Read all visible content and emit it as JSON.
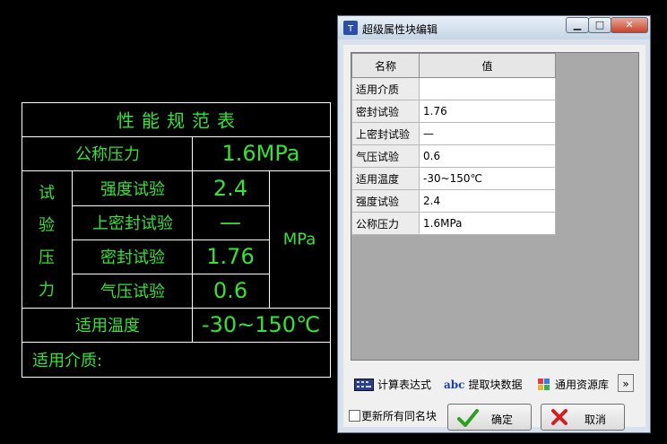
{
  "cad_table": {
    "title": "性能规范表",
    "nominal_pressure_label": "公称压力",
    "nominal_pressure_value": "1.6MPa",
    "group_label_chars": [
      "试",
      "验",
      "压",
      "力"
    ],
    "rows": [
      {
        "label": "强度试验",
        "value": "2.4"
      },
      {
        "label": "上密封试验",
        "value": "—"
      },
      {
        "label": "密封试验",
        "value": "1.76"
      },
      {
        "label": "气压试验",
        "value": "0.6"
      }
    ],
    "unit": "MPa",
    "temp_label": "适用温度",
    "temp_value": "-30~150℃",
    "medium_label": "适用介质:"
  },
  "dialog": {
    "title": "超级属性块编辑",
    "window_buttons": {
      "minimize": "▁",
      "maximize": "□",
      "close": "✕"
    },
    "grid": {
      "headers": [
        "名称",
        "值"
      ],
      "rows": [
        {
          "name": "适用介质",
          "value": ""
        },
        {
          "name": "密封试验",
          "value": "1.76"
        },
        {
          "name": "上密封试验",
          "value": "—"
        },
        {
          "name": "气压试验",
          "value": "0.6"
        },
        {
          "name": "适用温度",
          "value": "-30~150℃"
        },
        {
          "name": "强度试验",
          "value": "2.4"
        },
        {
          "name": "公称压力",
          "value": "1.6MPa"
        }
      ]
    },
    "toolbar": {
      "calc_label": "计算表达式",
      "abc_icon_text": "abc",
      "extract_label": "提取块数据",
      "resource_label": "通用资源库",
      "more_label": "»"
    },
    "update_all_label": "更新所有同名块",
    "ok_label": "确定",
    "cancel_label": "取消"
  },
  "colors": {
    "cad_text": "#36e236",
    "cad_lines": "#ffffff",
    "ok_check": "#2e9e1e",
    "cancel_x": "#d02020"
  }
}
